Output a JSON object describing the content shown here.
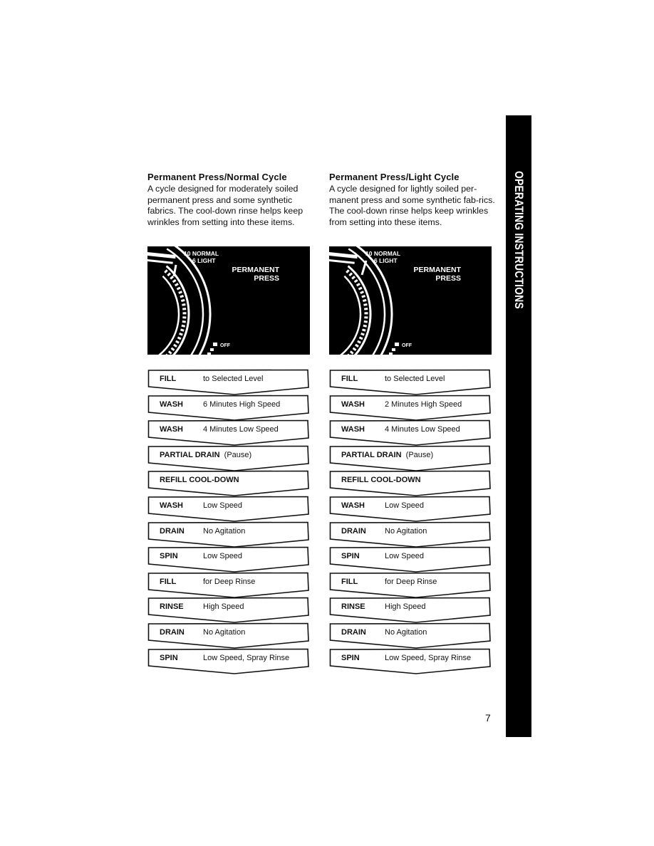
{
  "side_tab": {
    "text": "OPERATING INSTRUCTIONS"
  },
  "page_number": "7",
  "cycles": [
    {
      "title": "Permanent Press/Normal Cycle",
      "description": "A cycle designed for moderately soiled permanent press and some synthetic fabrics. The cool-down rinse helps keep wrinkles from setting into these items.",
      "dial": {
        "setting_top": "10 NORMAL",
        "setting_bottom": "6 LIGHT",
        "cycle_name_line1": "PERMANENT",
        "cycle_name_line2": "PRESS",
        "off_label": "OFF",
        "pointer_at": "10 NORMAL"
      },
      "steps": [
        {
          "label": "FILL",
          "detail": "to Selected Level"
        },
        {
          "label": "WASH",
          "detail": "6 Minutes High Speed"
        },
        {
          "label": "WASH",
          "detail": "4 Minutes Low Speed"
        },
        {
          "label": "PARTIAL DRAIN",
          "detail": "(Pause)",
          "inline": true
        },
        {
          "label": "REFILL COOL-DOWN",
          "detail": "",
          "inline": true
        },
        {
          "label": "WASH",
          "detail": "Low Speed"
        },
        {
          "label": "DRAIN",
          "detail": "No Agitation"
        },
        {
          "label": "SPIN",
          "detail": "Low Speed"
        },
        {
          "label": "FILL",
          "detail": "for Deep Rinse"
        },
        {
          "label": "RINSE",
          "detail": "High Speed"
        },
        {
          "label": "DRAIN",
          "detail": "No Agitation"
        },
        {
          "label": "SPIN",
          "detail": "Low Speed, Spray Rinse"
        }
      ]
    },
    {
      "title": "Permanent Press/Light Cycle",
      "description": "A cycle designed for lightly soiled per-manent press and some synthetic fab-rics. The cool-down rinse helps keep wrinkles from setting into these items.",
      "dial": {
        "setting_top": "10 NORMAL",
        "setting_bottom": "6 LIGHT",
        "cycle_name_line1": "PERMANENT",
        "cycle_name_line2": "PRESS",
        "off_label": "OFF",
        "pointer_at": "6 LIGHT"
      },
      "steps": [
        {
          "label": "FILL",
          "detail": "to Selected Level"
        },
        {
          "label": "WASH",
          "detail": "2 Minutes High Speed"
        },
        {
          "label": "WASH",
          "detail": "4 Minutes Low Speed"
        },
        {
          "label": "PARTIAL DRAIN",
          "detail": "(Pause)",
          "inline": true
        },
        {
          "label": "REFILL COOL-DOWN",
          "detail": "",
          "inline": true
        },
        {
          "label": "WASH",
          "detail": "Low Speed"
        },
        {
          "label": "DRAIN",
          "detail": "No Agitation"
        },
        {
          "label": "SPIN",
          "detail": "Low Speed"
        },
        {
          "label": "FILL",
          "detail": "for Deep Rinse"
        },
        {
          "label": "RINSE",
          "detail": "High Speed"
        },
        {
          "label": "DRAIN",
          "detail": "No Agitation"
        },
        {
          "label": "SPIN",
          "detail": "Low Speed, Spray Rinse"
        }
      ]
    }
  ]
}
